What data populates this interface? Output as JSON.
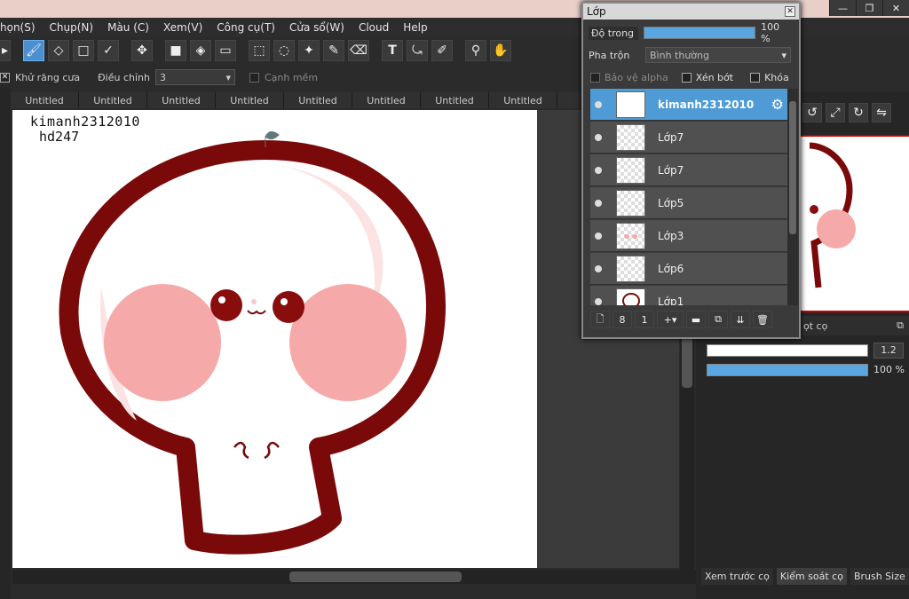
{
  "menu": [
    "họn(S)",
    "Chụp(N)",
    "Màu (C)",
    "Xem(V)",
    "Công cụ(T)",
    "Cửa sổ(W)",
    "Cloud",
    "Help"
  ],
  "window_buttons": [
    "—",
    "❐",
    "✕"
  ],
  "toolbar": {
    "icons": [
      "pointer-icon",
      "brush-icon",
      "eraser-icon",
      "rect-icon",
      "check-icon",
      "move-icon",
      "fill-rect-icon",
      "bucket-icon",
      "gradient-icon",
      "select-rect-icon",
      "select-lasso-icon",
      "magic-wand-icon",
      "select-pen-icon",
      "select-eraser-icon",
      "text-icon",
      "transform-icon",
      "pen-icon",
      "eyedropper-icon",
      "hand-icon"
    ]
  },
  "options": {
    "antialias_label": "Khử răng cưa",
    "adjust_label": "Điều chỉnh",
    "adjust_value": "3",
    "soft_edge_label": "Cạnh mềm"
  },
  "tabs": [
    "Untitled",
    "Untitled",
    "Untitled",
    "Untitled",
    "Untitled",
    "Untitled",
    "Untitled",
    "Untitled"
  ],
  "canvas_text": {
    "line1": "kimanh2312010",
    "line2": "hd247"
  },
  "layer_window": {
    "title": "Lớp",
    "opacity_label": "Độ trong",
    "opacity_value": "100 %",
    "opacity_fraction": 1.0,
    "blend_label": "Pha trộn",
    "blend_value": "Bình thường",
    "protect_alpha": "Bảo vệ alpha",
    "clip": "Xén bớt",
    "lock": "Khóa",
    "layers": [
      "kimanh2312010",
      "Lớp7",
      "Lớp7",
      "Lớp5",
      "Lớp3",
      "Lớp6",
      "Lớp1"
    ],
    "selected_index": 0
  },
  "right_panel": {
    "brush_size_value": "1.2",
    "brush_opacity_value": "100 %",
    "partial_label": "ọt cọ",
    "tabs": [
      "Xem trước cọ",
      "Kiểm soát cọ",
      "Brush Size"
    ]
  },
  "colors": {
    "accent": "#4e9bd6",
    "dark_red": "#7a0a0a",
    "cheek_pink": "#f6a9a9"
  }
}
